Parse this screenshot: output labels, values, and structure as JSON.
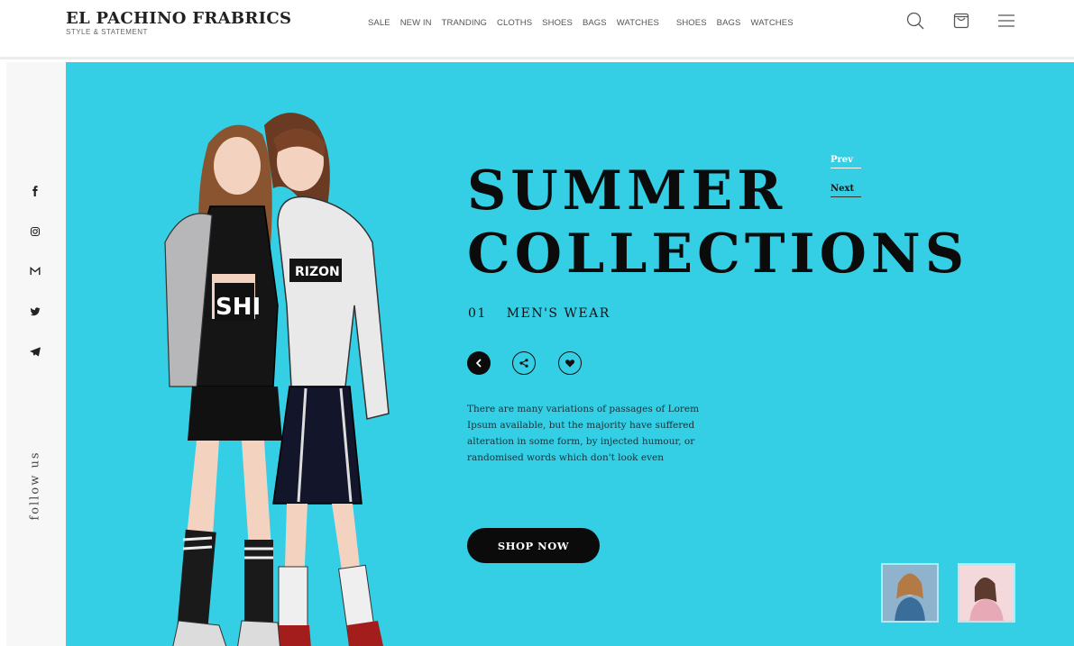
{
  "header": {
    "brand": "EL PACHINO FRABRICS",
    "tagline": "STYLE & STATEMENT",
    "nav": [
      "SALE",
      "NEW IN",
      "TRANDING",
      "CLOTHS",
      "SHOES",
      "BAGS",
      "WATCHES",
      "SHOES",
      "BAGS",
      "WATCHES"
    ],
    "icons": [
      "search-icon",
      "shopping-bag-icon",
      "menu-icon"
    ]
  },
  "sidebar": {
    "social": [
      "facebook-icon",
      "instagram-icon",
      "gmail-icon",
      "twitter-icon",
      "telegram-icon"
    ],
    "follow_label": "follow us"
  },
  "hero": {
    "title_line1": "SUMMER",
    "title_line2": "COLLECTIONS",
    "number": "01",
    "category": "MEN'S WEAR",
    "prev_label": "Prev",
    "next_label": "Next",
    "description": "There are many variations of passages of Lorem Ipsum available, but the majority have suffered alteration in some form, by injected humour, or randomised words which don't look even",
    "cta_label": "SHOP NOW",
    "actions": [
      "chevron-left-icon",
      "share-icon",
      "heart-icon"
    ],
    "thumbnails": [
      "thumbnail-girl-blue-jacket",
      "thumbnail-girl-pink"
    ]
  },
  "colors": {
    "hero_bg": "#35cfe5",
    "dark": "#0b0b0b",
    "rail_bg": "#f7f7f7"
  }
}
